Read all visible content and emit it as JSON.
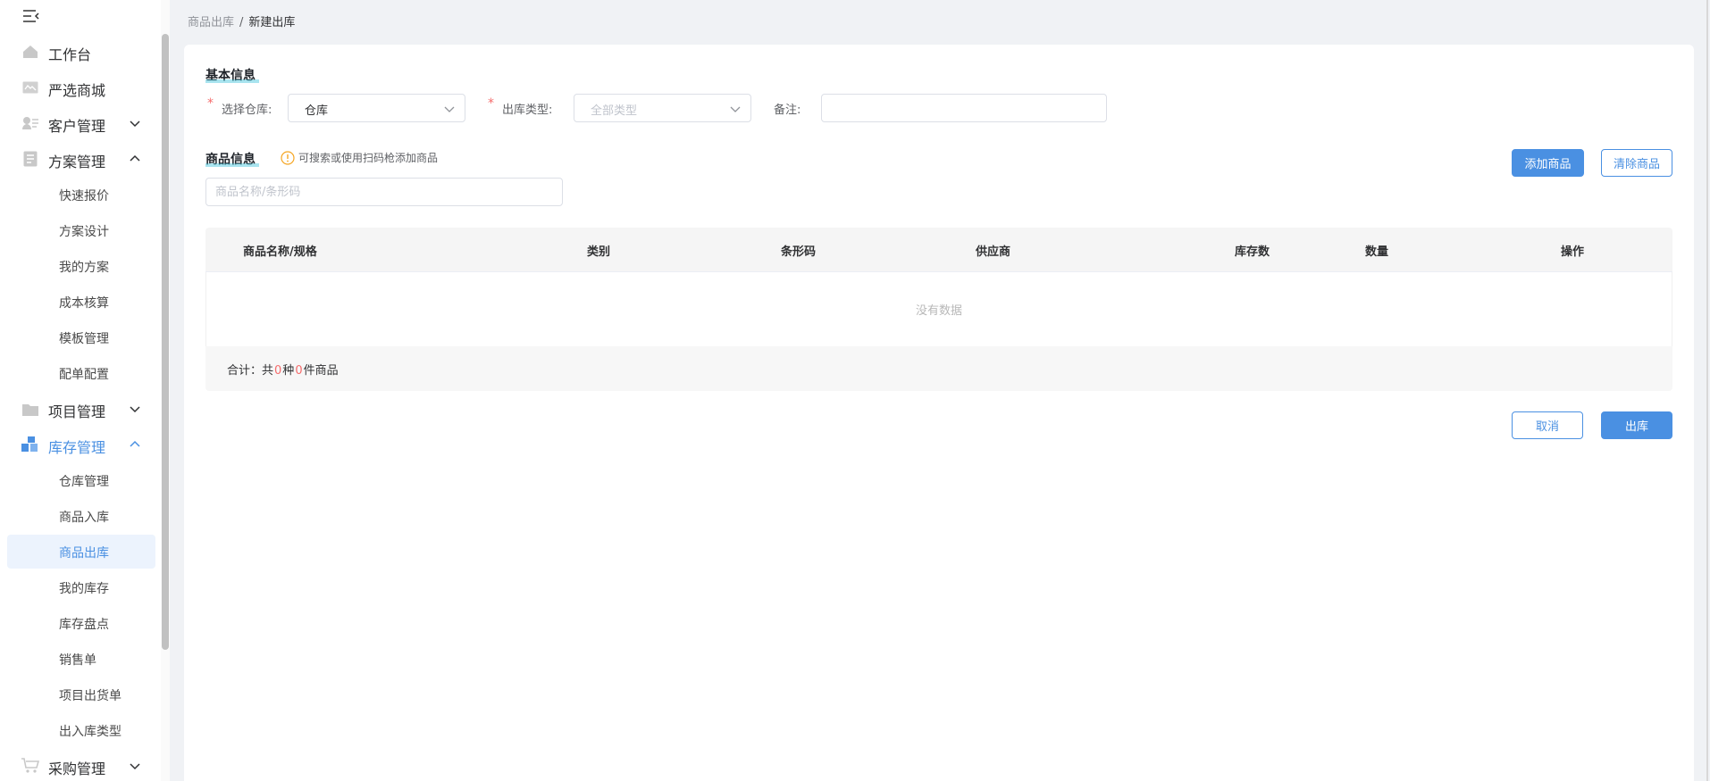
{
  "sidebar": {
    "menu": [
      {
        "label": "工作台",
        "icon": "home-icon"
      },
      {
        "label": "严选商城",
        "icon": "mall-icon"
      },
      {
        "label": "客户管理",
        "icon": "customer-icon"
      },
      {
        "label": "方案管理",
        "icon": "plan-icon"
      },
      {
        "label": "项目管理",
        "icon": "folder-icon"
      },
      {
        "label": "库存管理",
        "icon": "inventory-icon"
      },
      {
        "label": "采购管理",
        "icon": "cart-icon"
      }
    ],
    "plan_sub": [
      "快速报价",
      "方案设计",
      "我的方案",
      "成本核算",
      "模板管理",
      "配单配置"
    ],
    "inventory_sub": [
      "仓库管理",
      "商品入库",
      "商品出库",
      "我的库存",
      "库存盘点",
      "销售单",
      "项目出货单",
      "出入库类型"
    ],
    "active_item": "商品出库"
  },
  "breadcrumb": {
    "parent": "商品出库",
    "separator": "/",
    "current": "新建出库"
  },
  "basic_info": {
    "title": "基本信息",
    "warehouse_label": "选择仓库:",
    "warehouse_value": "仓库",
    "type_label": "出库类型:",
    "type_placeholder": "全部类型",
    "remark_label": "备注:",
    "remark_value": ""
  },
  "goods_info": {
    "title": "商品信息",
    "hint": "可搜索或使用扫码枪添加商品",
    "search_placeholder": "商品名称/条形码",
    "add_button": "添加商品",
    "clear_button": "清除商品"
  },
  "table": {
    "columns": [
      "商品名称/规格",
      "类别",
      "条形码",
      "供应商",
      "库存数",
      "数量",
      "操作"
    ],
    "empty_text": "没有数据",
    "total_prefix": "合计：共",
    "kinds": "0",
    "kinds_unit": "种",
    "count": "0",
    "count_unit": "件商品"
  },
  "actions": {
    "cancel": "取消",
    "submit": "出库"
  },
  "colors": {
    "primary": "#4a90e2",
    "danger": "#f56c6c",
    "active_bg": "#ecf3fd"
  }
}
